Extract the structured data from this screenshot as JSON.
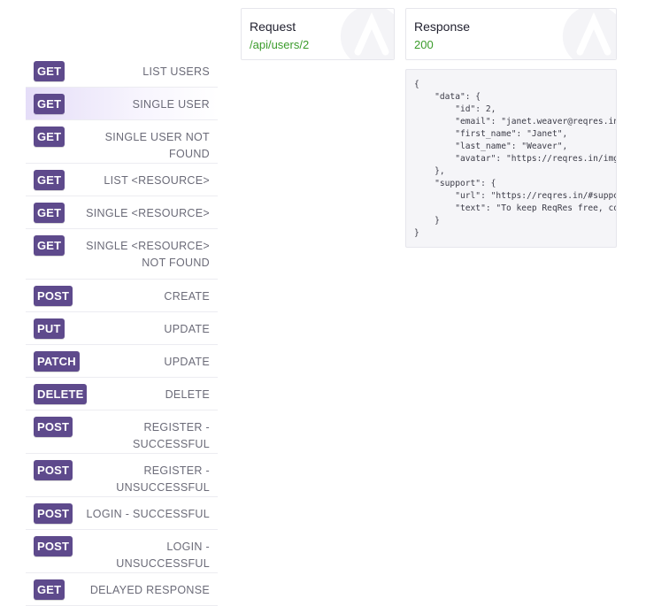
{
  "endpoints": [
    {
      "method": "GET",
      "label": "LIST USERS"
    },
    {
      "method": "GET",
      "label": "SINGLE USER"
    },
    {
      "method": "GET",
      "label": "SINGLE USER NOT FOUND"
    },
    {
      "method": "GET",
      "label": "LIST <RESOURCE>"
    },
    {
      "method": "GET",
      "label": "SINGLE <RESOURCE>"
    },
    {
      "method": "GET",
      "label": "SINGLE <RESOURCE> NOT FOUND"
    },
    {
      "method": "POST",
      "label": "CREATE"
    },
    {
      "method": "PUT",
      "label": "UPDATE"
    },
    {
      "method": "PATCH",
      "label": "UPDATE"
    },
    {
      "method": "DELETE",
      "label": "DELETE"
    },
    {
      "method": "POST",
      "label": "REGISTER - SUCCESSFUL"
    },
    {
      "method": "POST",
      "label": "REGISTER - UNSUCCESSFUL"
    },
    {
      "method": "POST",
      "label": "LOGIN - SUCCESSFUL"
    },
    {
      "method": "POST",
      "label": "LOGIN - UNSUCCESSFUL"
    },
    {
      "method": "GET",
      "label": "DELAYED RESPONSE"
    }
  ],
  "active_endpoint": "SINGLE USER",
  "request": {
    "title": "Request",
    "value": "/api/users/2"
  },
  "response": {
    "title": "Response",
    "status": "200",
    "body": "{\n    \"data\": {\n        \"id\": 2,\n        \"email\": \"janet.weaver@reqres.in\",\n        \"first_name\": \"Janet\",\n        \"last_name\": \"Weaver\",\n        \"avatar\": \"https://reqres.in/img/fa\n    },\n    \"support\": {\n        \"url\": \"https://reqres.in/#support-\n        \"text\": \"To keep ReqRes free, contr\n    }\n}"
  },
  "colors": {
    "method_badge": "#5e4a8c",
    "status_ok": "#3a9b2a",
    "active_row": "#e8e0f7"
  }
}
